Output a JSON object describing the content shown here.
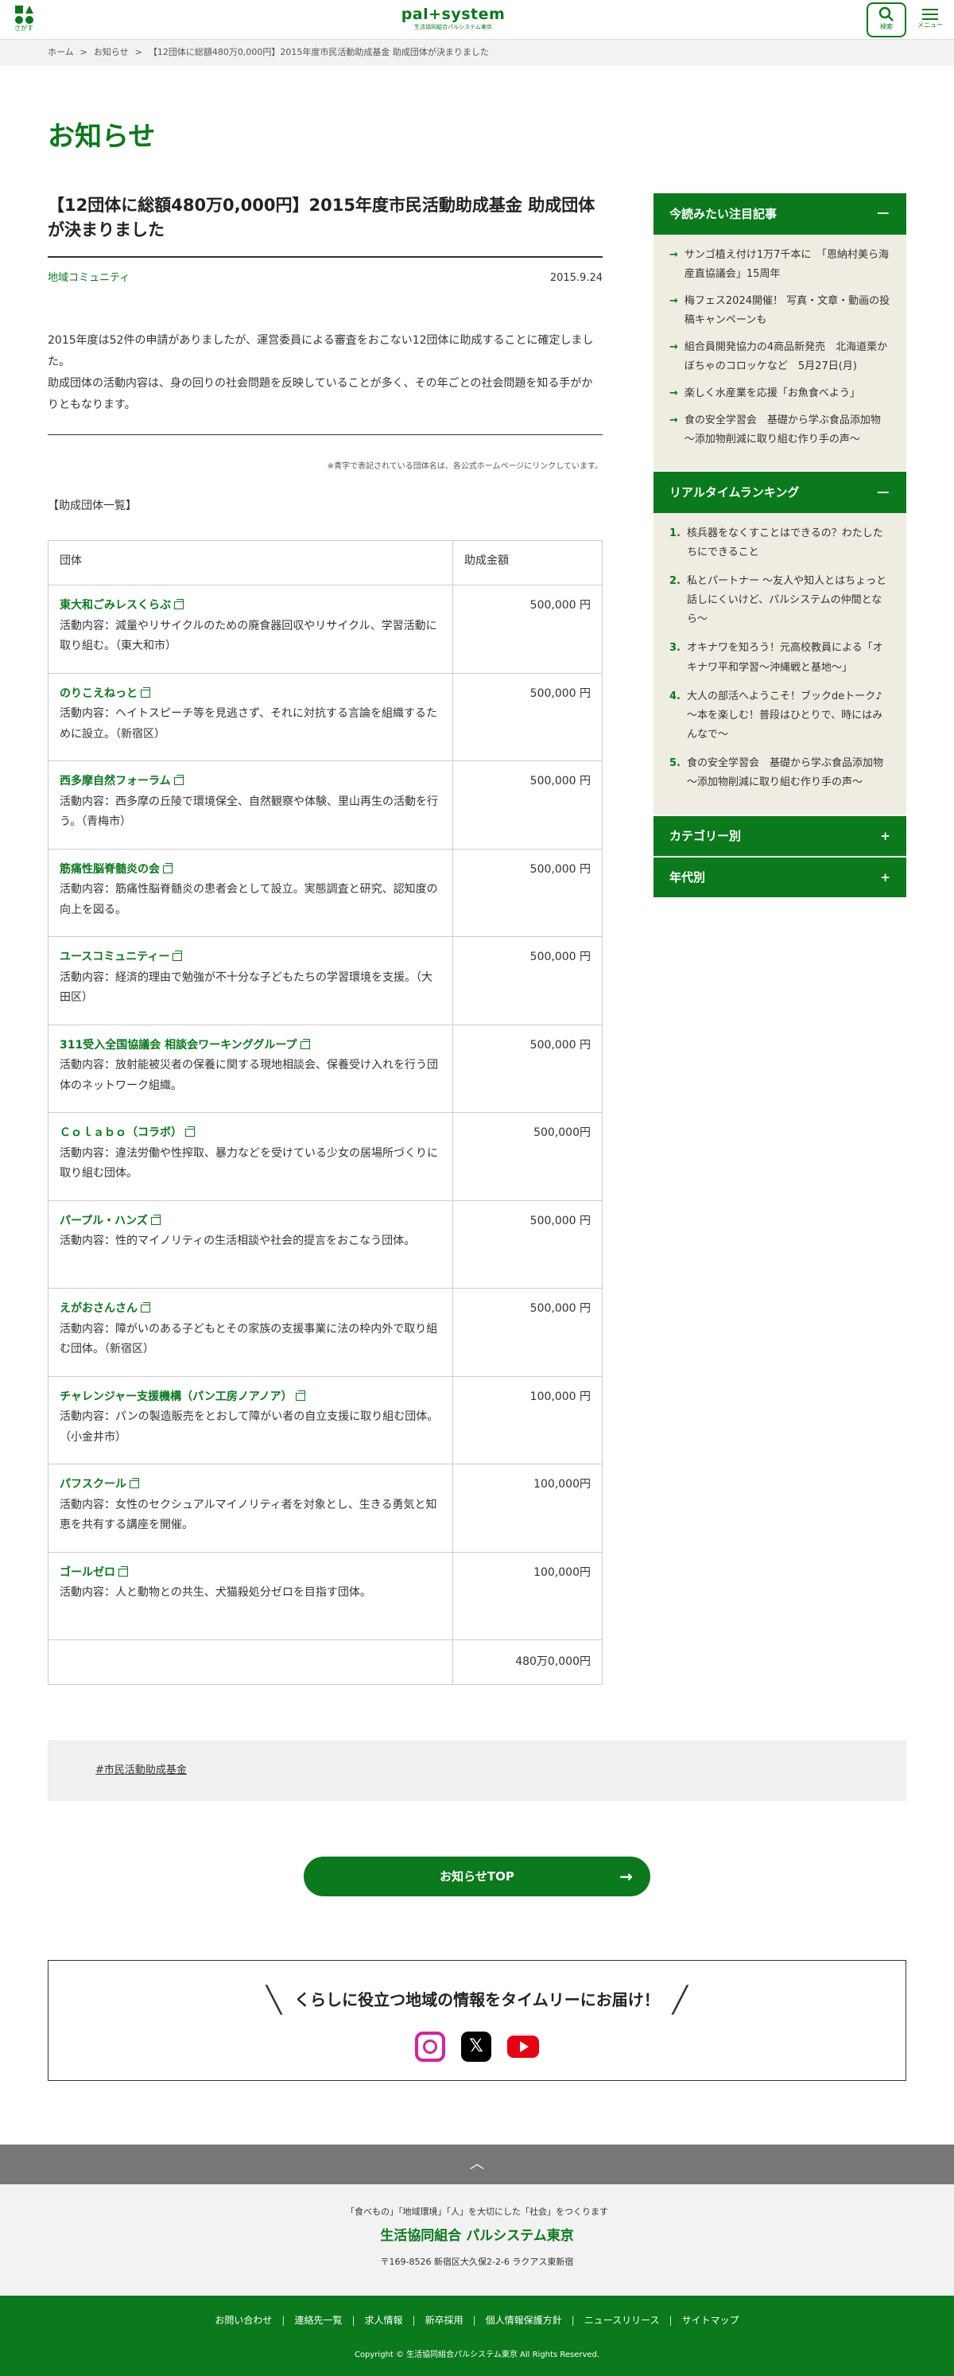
{
  "header": {
    "search_short_label": "さがす",
    "logo_main": "pal+system",
    "logo_sub": "生活協同組合パルシステム東京",
    "search_label": "検索",
    "menu_label": "メニュー"
  },
  "breadcrumb": {
    "home": "ホーム",
    "section": "お知らせ",
    "current": "【12団体に総額480万0,000円】2015年度市民活動助成基金 助成団体が決まりました",
    "sep": ">"
  },
  "page_title": "お知らせ",
  "article": {
    "title": "【12団体に総額480万0,000円】2015年度市民活動助成基金 助成団体が決まりました",
    "category": "地域コミュニティ",
    "date": "2015.9.24",
    "body": [
      "2015年度は52件の申請がありましたが、運営委員による審査をおこない12団体に助成することに確定しました。",
      "助成団体の活動内容は、身の回りの社会問題を反映していることが多く、その年ごとの社会問題を知る手がかりともなります。"
    ],
    "note": "※青字で表記されている団体名は、各公式ホームページにリンクしています。",
    "list_heading": "【助成団体一覧】"
  },
  "table": {
    "col_org": "団体",
    "col_amount": "助成金額",
    "rows": [
      {
        "name": "東大和ごみレスくらぶ",
        "desc": "活動内容：減量やリサイクルのための廃食器回収やリサイクル、学習活動に取り組む。（東大和市）",
        "amount": "500,000 円"
      },
      {
        "name": "のりこえねっと",
        "desc": "活動内容：ヘイトスピーチ等を見逃さず、それに対抗する言論を組織するために設立。（新宿区）",
        "amount": "500,000 円"
      },
      {
        "name": "西多摩自然フォーラム",
        "desc": "活動内容：西多摩の丘陵で環境保全、自然観察や体験、里山再生の活動を行う。（青梅市）",
        "amount": "500,000 円"
      },
      {
        "name": "筋痛性脳脊髄炎の会",
        "desc": "活動内容：筋痛性脳脊髄炎の患者会として設立。実態調査と研究、認知度の向上を図る。",
        "amount": "500,000 円"
      },
      {
        "name": "ユースコミュニティー",
        "desc": "活動内容：経済的理由で勉強が不十分な子どもたちの学習環境を支援。（大田区）",
        "amount": "500,000 円"
      },
      {
        "name": "311受入全国協議会 相談会ワーキンググループ",
        "desc": "活動内容：放射能被災者の保養に関する現地相談会、保養受け入れを行う団体のネットワーク組織。",
        "amount": "500,000 円"
      },
      {
        "name": "Ｃｏｌａｂｏ（コラボ）",
        "desc": "活動内容：違法労働や性搾取、暴力などを受けている少女の居場所づくりに取り組む団体。",
        "amount": "500,000円"
      },
      {
        "name": "パープル・ハンズ",
        "desc": "活動内容：性的マイノリティの生活相談や社会的提言をおこなう団体。",
        "amount": "500,000 円"
      },
      {
        "name": "えがおさんさん",
        "desc": "活動内容：障がいのある子どもとその家族の支援事業に法の枠内外で取り組む団体。（新宿区）",
        "amount": "500,000 円"
      },
      {
        "name": "チャレンジャー支援機構（パン工房ノアノア）",
        "desc": "活動内容：パンの製造販売をとおして障がい者の自立支援に取り組む団体。（小金井市）",
        "amount": "100,000 円"
      },
      {
        "name": "パフスクール",
        "desc": "活動内容：女性のセクシュアルマイノリティ者を対象とし、生きる勇気と知恵を共有する講座を開催。",
        "amount": "100,000円"
      },
      {
        "name": "ゴールゼロ",
        "desc": "活動内容：人と動物との共生、犬猫殺処分ゼロを目指す団体。",
        "amount": "100,000円"
      }
    ],
    "total": "480万0,000円"
  },
  "sidebar": {
    "pickup_title": "今読みたい注目記事",
    "pickup": [
      "サンゴ植え付け1万7千本に　「恩納村美ら海産直協議会」15周年",
      "梅フェス2024開催！ 写真・文章・動画の投稿キャンペーンも",
      "組合員開発協力の4商品新発売　北海道栗かぼちゃのコロッケなど　5月27日(月)",
      "楽しく水産業を応援「お魚食べよう」",
      "食の安全学習会　基礎から学ぶ食品添加物　～添加物削減に取り組む作り手の声～"
    ],
    "ranking_title": "リアルタイムランキング",
    "ranking": [
      {
        "num": "1.",
        "text": "核兵器をなくすことはできるの？わたしたちにできること"
      },
      {
        "num": "2.",
        "text": "私とパートナー ～友人や知人とはちょっと話しにくいけど、パルシステムの仲間となら～"
      },
      {
        "num": "3.",
        "text": "オキナワを知ろう！元高校教員による「オキナワ平和学習～沖縄戦と基地～」"
      },
      {
        "num": "4.",
        "text": "大人の部活へようこそ！ブックdeトーク♪ ～本を楽しむ！普段はひとりで、時にはみんなで～"
      },
      {
        "num": "5.",
        "text": "食の安全学習会　基礎から学ぶ食品添加物　～添加物削減に取り組む作り手の声～"
      }
    ],
    "category_title": "カテゴリー別",
    "year_title": "年代別",
    "minus": "−",
    "plus": "+"
  },
  "tag": "#市民活動助成基金",
  "top_button": "お知らせTOP",
  "sns_title": "くらしに役立つ地域の情報をタイムリーにお届け！",
  "footer": {
    "tagline": "「食べもの」「地域環境」「人」を大切にした「社会」をつくります",
    "org": "生活協同組合 パルシステム東京",
    "address": "〒169-8526 新宿区大久保2-2-6 ラクアス東新宿",
    "links": [
      "お問い合わせ",
      "連絡先一覧",
      "求人情報",
      "新卒採用",
      "個人情報保護方針",
      "ニュースリリース",
      "サイトマップ"
    ],
    "copyright": "Copyright © 生活協同組合パルシステム東京 All Rights Reserved."
  }
}
